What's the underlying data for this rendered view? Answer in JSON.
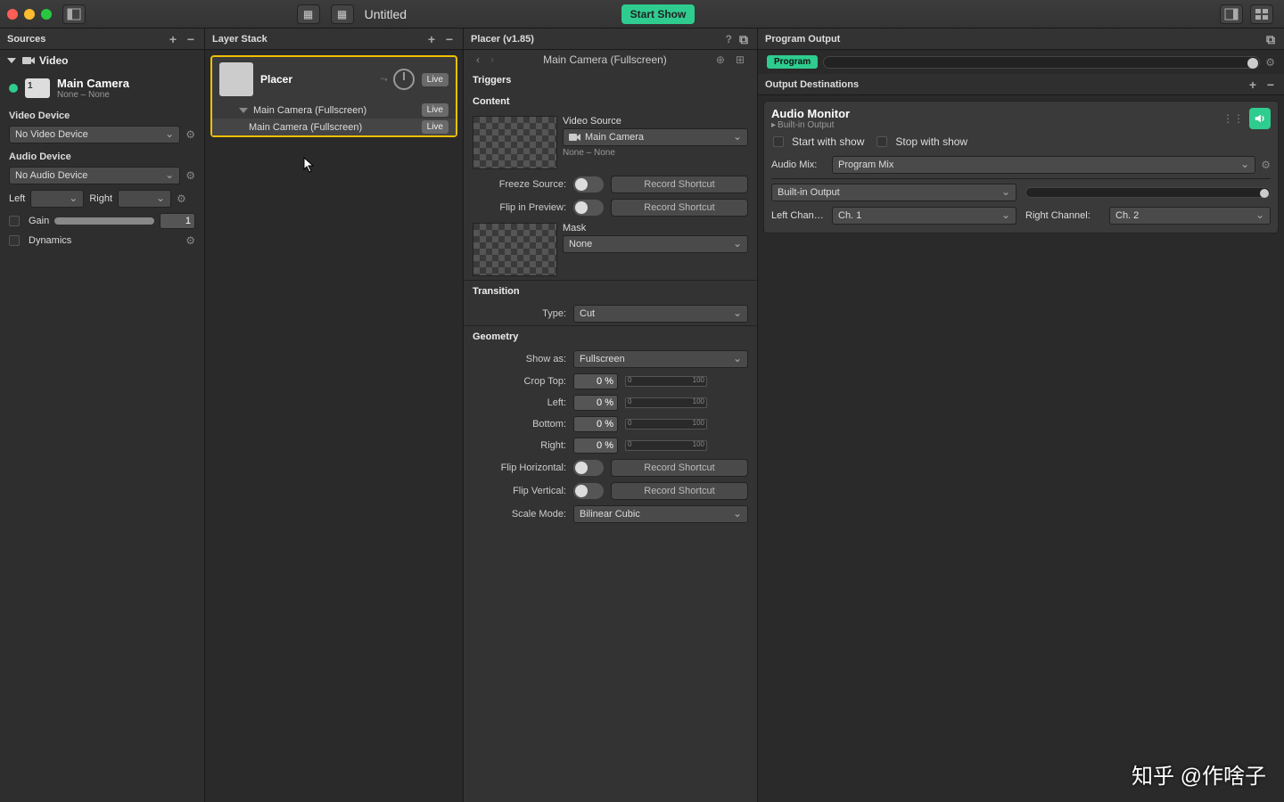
{
  "window": {
    "title": "Untitled",
    "start_show": "Start Show"
  },
  "sources": {
    "header": "Sources",
    "video_group": "Video",
    "item": {
      "title": "Main Camera",
      "sub": "None – None"
    },
    "video_device_label": "Video Device",
    "video_device_value": "No Video Device",
    "audio_device_label": "Audio Device",
    "audio_device_value": "No Audio Device",
    "left_label": "Left",
    "right_label": "Right",
    "gain_label": "Gain",
    "gain_value": "1",
    "dynamics_label": "Dynamics"
  },
  "layers": {
    "header": "Layer Stack",
    "card": {
      "title": "Placer",
      "live": "Live",
      "rows": [
        {
          "label": "Main Camera (Fullscreen)",
          "badge": "Live"
        },
        {
          "label": "Main Camera (Fullscreen)",
          "badge": "Live"
        }
      ]
    }
  },
  "inspector": {
    "header": "Placer (v1.85)",
    "breadcrumb": "Main Camera (Fullscreen)",
    "triggers": "Triggers",
    "content": "Content",
    "video_source_label": "Video Source",
    "video_source_value": "Main Camera",
    "video_source_sub": "None – None",
    "freeze_label": "Freeze Source:",
    "flip_preview_label": "Flip in Preview:",
    "record_shortcut": "Record Shortcut",
    "mask_label": "Mask",
    "mask_value": "None",
    "transition": "Transition",
    "type_label": "Type:",
    "type_value": "Cut",
    "geometry": "Geometry",
    "show_as_label": "Show as:",
    "show_as_value": "Fullscreen",
    "crop_top": "Crop Top:",
    "crop_left": "Left:",
    "crop_bottom": "Bottom:",
    "crop_right": "Right:",
    "crop_val": "0 %",
    "slider_min": "0",
    "slider_max": "100",
    "flip_h": "Flip Horizontal:",
    "flip_v": "Flip Vertical:",
    "scale_mode_label": "Scale Mode:",
    "scale_mode_value": "Bilinear Cubic"
  },
  "output": {
    "program_output": "Program Output",
    "program": "Program",
    "dest_header": "Output Destinations",
    "audio": {
      "title": "Audio Monitor",
      "sub": "Built-in Output",
      "start_with_show": "Start with show",
      "stop_with_show": "Stop with show",
      "audio_mix_label": "Audio Mix:",
      "audio_mix_value": "Program Mix",
      "device_value": "Built-in Output",
      "left_ch_label": "Left Chan…",
      "left_ch_value": "Ch. 1",
      "right_ch_label": "Right Channel:",
      "right_ch_value": "Ch. 2"
    }
  },
  "watermark": "知乎 @作啥子"
}
